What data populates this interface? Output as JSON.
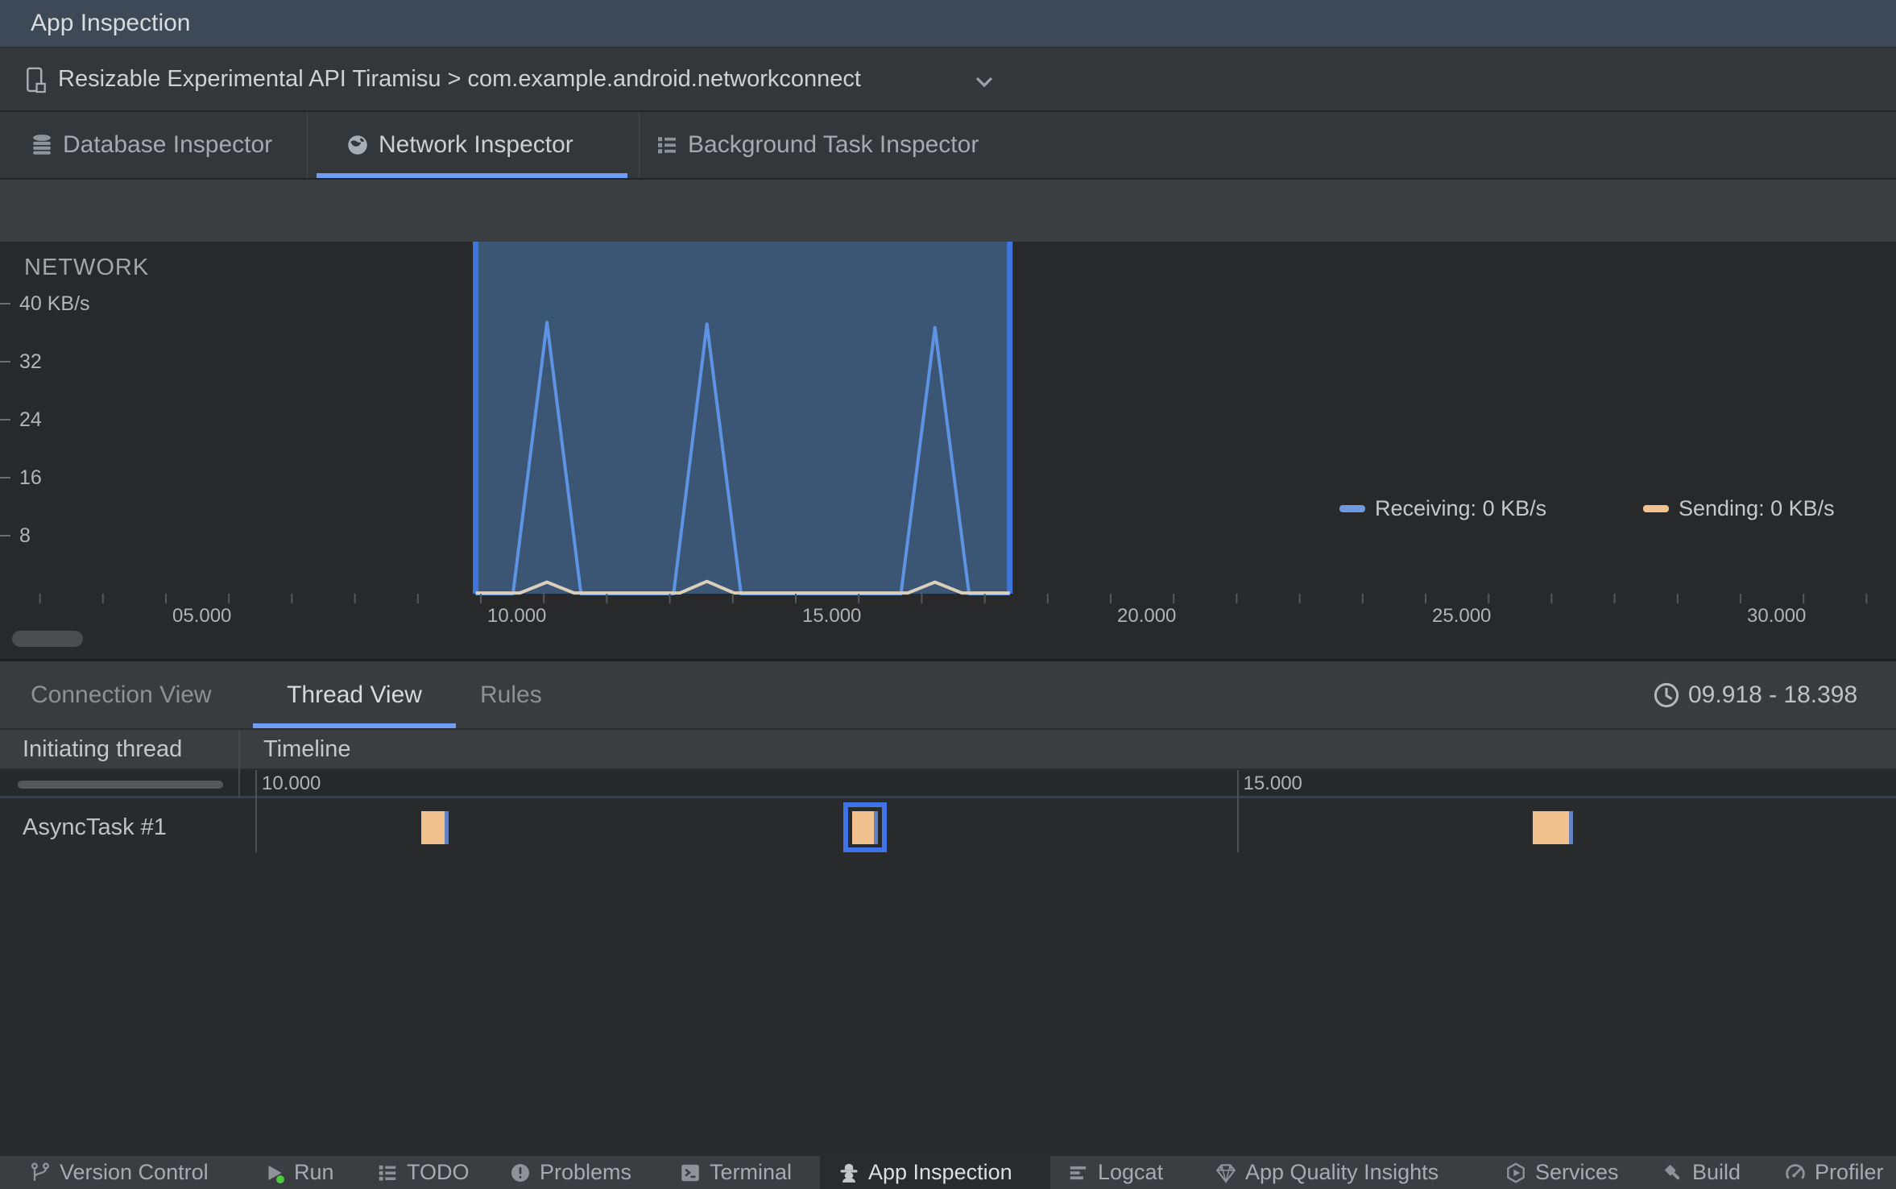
{
  "window": {
    "title": "App Inspection"
  },
  "device_bar": {
    "label": "Resizable Experimental API Tiramisu > com.example.android.networkconnect",
    "icon": "resizable-device-icon"
  },
  "inspector_tabs": {
    "tabs": [
      {
        "label": "Database Inspector",
        "icon": "database-icon",
        "selected": false
      },
      {
        "label": "Network Inspector",
        "icon": "globe-icon",
        "selected": true
      },
      {
        "label": "Background Task Inspector",
        "icon": "task-list-icon",
        "selected": false
      }
    ]
  },
  "colors": {
    "accent_blue": "#6f9df3",
    "selection_fill": "#3b5675",
    "selection_border": "#3f74dc",
    "receiving_line": "#5e93e3",
    "receiving_legend": "#6d9be0",
    "sending_line": "#d9cfba",
    "sending_legend": "#f2c28c",
    "block_fill": "#f2c28e",
    "block_receiving": "#6282c2",
    "block_selected_border": "#3e74e8",
    "run_green": "#4fcb3f",
    "tick_color": "#55585a",
    "ytick_color": "#6b6e71"
  },
  "chart_data": {
    "type": "area",
    "title": "NETWORK",
    "ylabel": "KB/s",
    "grid": false,
    "legend_position": "top-right",
    "xlim": [
      2.37,
      32.47
    ],
    "ylim": [
      0,
      48.6
    ],
    "x_axis": {
      "minor_tick_every_s": 1,
      "labels": [
        {
          "t": 5,
          "text": "05.000"
        },
        {
          "t": 10,
          "text": "10.000"
        },
        {
          "t": 15,
          "text": "15.000"
        },
        {
          "t": 20,
          "text": "20.000"
        },
        {
          "t": 25,
          "text": "25.000"
        },
        {
          "t": 30,
          "text": "30.000"
        }
      ]
    },
    "y_axis": {
      "ticks": [
        {
          "v": 40,
          "text": "40 KB/s"
        },
        {
          "v": 32,
          "text": "32"
        },
        {
          "v": 24,
          "text": "24"
        },
        {
          "v": 16,
          "text": "16"
        },
        {
          "v": 8,
          "text": "8"
        }
      ]
    },
    "selection": {
      "start_s": 9.918,
      "end_s": 18.398
    },
    "legend": [
      {
        "name": "Receiving",
        "label": "Receiving: 0 KB/s"
      },
      {
        "name": "Sending",
        "label": "Sending: 0 KB/s"
      }
    ],
    "series": [
      {
        "name": "Receiving",
        "points": [
          [
            9.918,
            0
          ],
          [
            10.51,
            0
          ],
          [
            11.05,
            37.4
          ],
          [
            11.59,
            0
          ],
          [
            13.06,
            0
          ],
          [
            13.59,
            37.2
          ],
          [
            14.13,
            0
          ],
          [
            16.67,
            0
          ],
          [
            17.21,
            36.7
          ],
          [
            17.75,
            0
          ],
          [
            18.398,
            0
          ]
        ]
      },
      {
        "name": "Sending",
        "points": [
          [
            9.918,
            0.1
          ],
          [
            10.62,
            0.1
          ],
          [
            11.05,
            1.6
          ],
          [
            11.48,
            0.1
          ],
          [
            13.16,
            0.1
          ],
          [
            13.59,
            1.7
          ],
          [
            14.02,
            0.1
          ],
          [
            16.78,
            0.1
          ],
          [
            17.21,
            1.6
          ],
          [
            17.64,
            0.1
          ],
          [
            18.398,
            0.1
          ]
        ]
      }
    ]
  },
  "thread_panel": {
    "view_tabs": [
      {
        "label": "Connection View",
        "selected": false
      },
      {
        "label": "Thread View",
        "selected": true
      },
      {
        "label": "Rules",
        "selected": false
      }
    ],
    "time_range": "09.918 - 18.398",
    "columns": [
      "Initiating thread",
      "Timeline"
    ],
    "scale_labels": [
      {
        "t": 10,
        "text": "10.000"
      },
      {
        "t": 15,
        "text": "15.000"
      }
    ],
    "rows": [
      {
        "thread": "AsyncTask #1",
        "blocks": [
          {
            "start_s": 10.845,
            "send_end_s": 10.965,
            "end_s": 10.985,
            "selected": false
          },
          {
            "start_s": 13.041,
            "send_end_s": 13.152,
            "end_s": 13.172,
            "selected": true
          },
          {
            "start_s": 16.508,
            "send_end_s": 16.693,
            "end_s": 16.713,
            "selected": false
          }
        ]
      }
    ]
  },
  "bottom_bar": {
    "items": [
      {
        "label": "Version Control",
        "icon": "branch-icon",
        "selected": false
      },
      {
        "label": "Run",
        "icon": "run-icon",
        "selected": false
      },
      {
        "label": "TODO",
        "icon": "todo-list-icon",
        "selected": false
      },
      {
        "label": "Problems",
        "icon": "problems-icon",
        "selected": false
      },
      {
        "label": "Terminal",
        "icon": "terminal-icon",
        "selected": false
      },
      {
        "label": "App Inspection",
        "icon": "inspector-icon",
        "selected": true
      },
      {
        "label": "Logcat",
        "icon": "logcat-icon",
        "selected": false
      },
      {
        "label": "App Quality Insights",
        "icon": "diamond-icon",
        "selected": false
      },
      {
        "label": "Services",
        "icon": "services-icon",
        "selected": false
      },
      {
        "label": "Build",
        "icon": "build-icon",
        "selected": false
      },
      {
        "label": "Profiler",
        "icon": "profiler-icon",
        "selected": false
      }
    ]
  }
}
